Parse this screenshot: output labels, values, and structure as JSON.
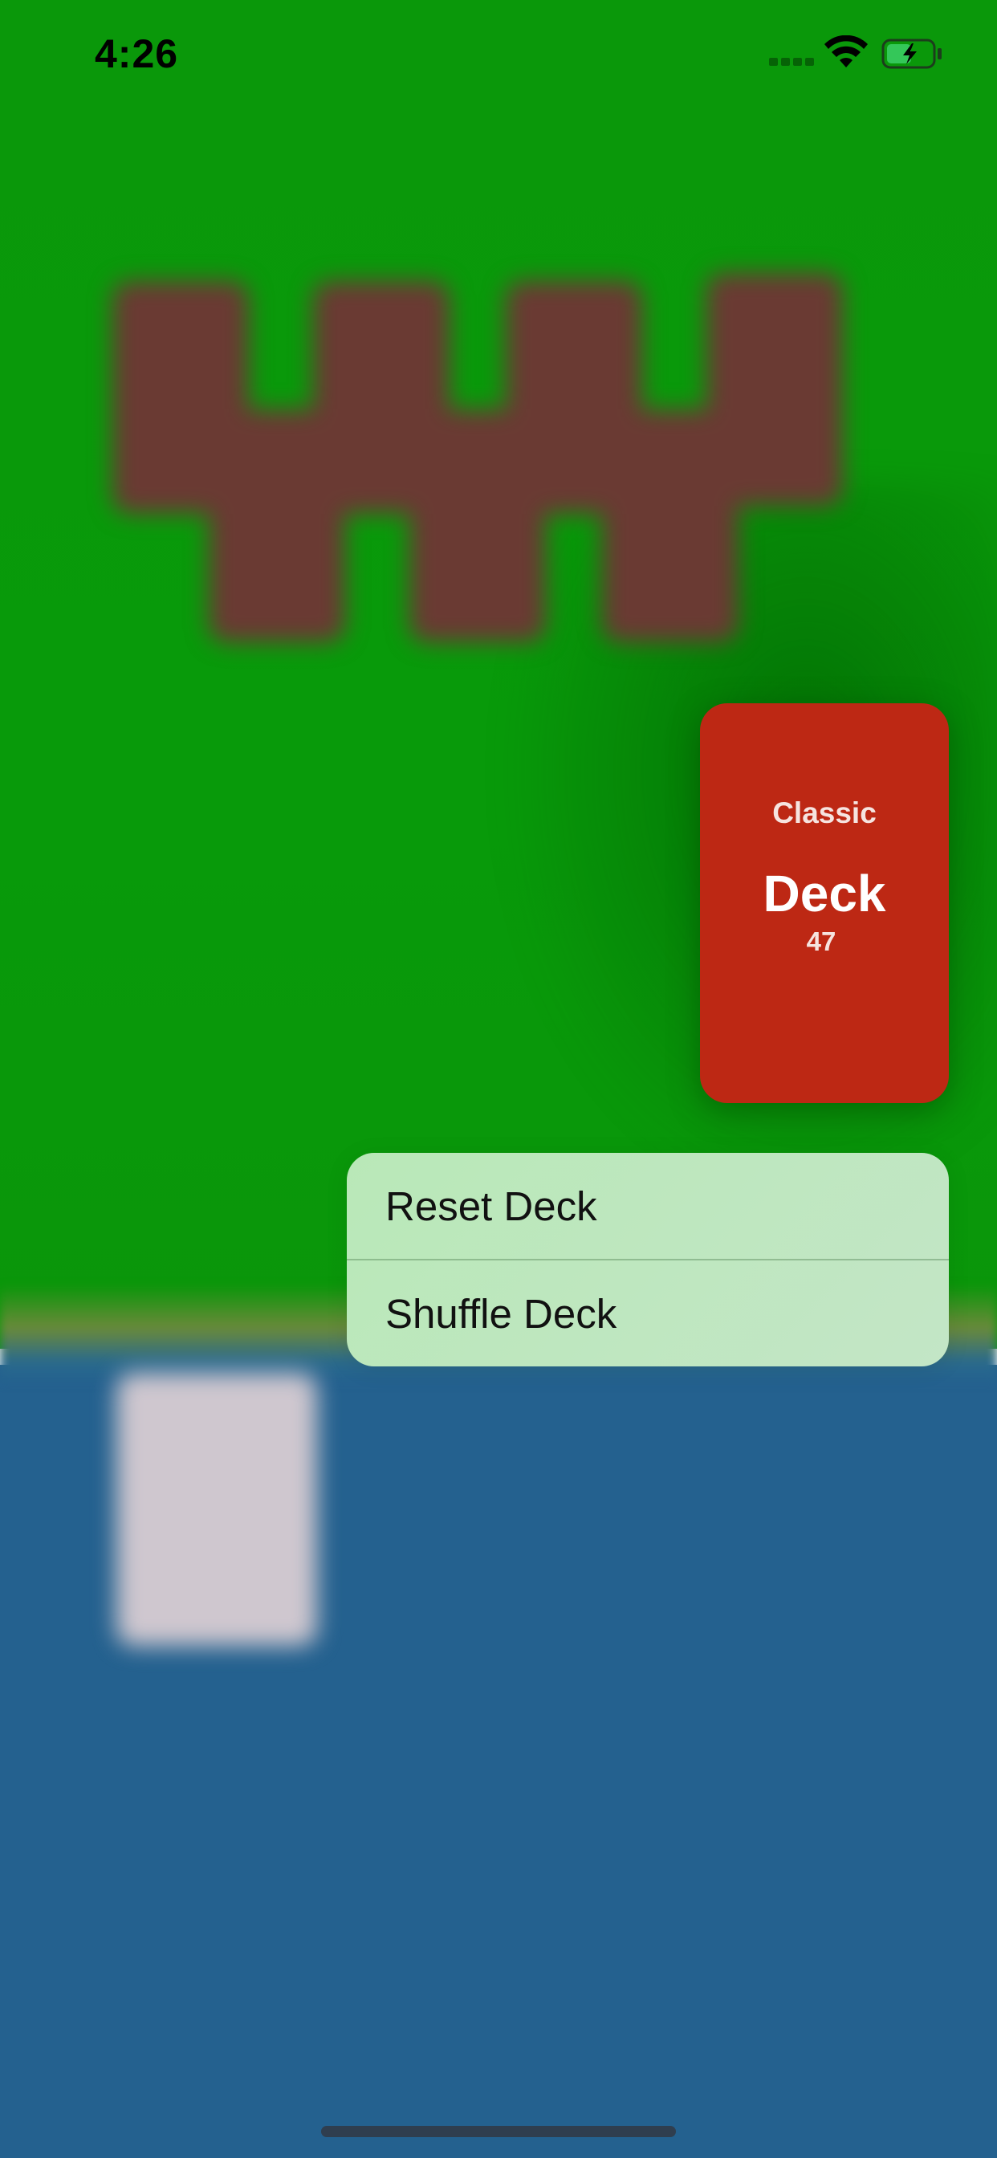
{
  "status_bar": {
    "time": "4:26",
    "signal_icon": "cellular-signal-icon",
    "wifi_icon": "wifi-icon",
    "battery_icon": "battery-charging-icon",
    "battery_color": "#34c759"
  },
  "background": {
    "table_color": "#0a980a",
    "lower_area_color": "#24618f"
  },
  "deck_card": {
    "subtitle": "Classic",
    "title": "Deck",
    "count": "47",
    "color": "#bd2814"
  },
  "context_menu": {
    "items": [
      {
        "label": "Reset Deck"
      },
      {
        "label": "Shuffle Deck"
      }
    ]
  }
}
